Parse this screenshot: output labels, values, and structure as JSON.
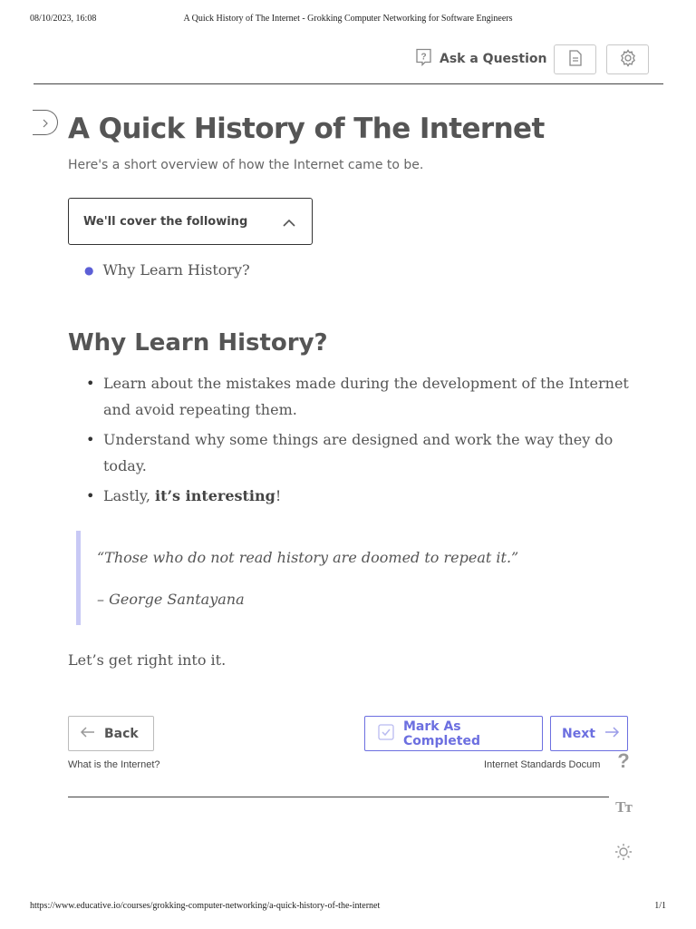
{
  "print_header": {
    "datetime": "08/10/2023, 16:08",
    "title": "A Quick History of The Internet - Grokking Computer Networking for Software Engineers"
  },
  "toolbar": {
    "ask_label": "Ask a Question",
    "icons": [
      "question-box-icon",
      "document-icon",
      "gear-icon"
    ]
  },
  "lesson": {
    "title": "A Quick History of The Internet",
    "subtitle": "Here's a short overview of how the Internet came to be.",
    "toc_label": "We'll cover the following",
    "toc_items": [
      "Why Learn History?"
    ],
    "section_heading": "Why Learn History?",
    "bullets": [
      "Learn about the mistakes made during the development of the Internet and avoid repeating them.",
      "Understand why some things are designed and work the way they do today."
    ],
    "bullet3_prefix": "Lastly, ",
    "bullet3_bold": "it’s interesting",
    "bullet3_suffix": "!",
    "quote_text": "“Those who do not read history are doomed to repeat it.”",
    "quote_author": "– George Santayana",
    "closing": "Let’s get right into it."
  },
  "navigation": {
    "back_label": "Back",
    "mark_label": "Mark As Completed",
    "next_label": "Next",
    "prev_lesson": "What is the Internet?",
    "next_lesson": "Internet Standards Docum"
  },
  "side_tools": {
    "help_glyph": "?",
    "font_glyph": "Tт"
  },
  "print_footer": {
    "url": "https://www.educative.io/courses/grokking-computer-networking/a-quick-history-of-the-internet",
    "page": "1/1"
  },
  "colors": {
    "accent": "#6c6fe0",
    "quote_border": "#c8c9f5",
    "text": "#555555"
  }
}
